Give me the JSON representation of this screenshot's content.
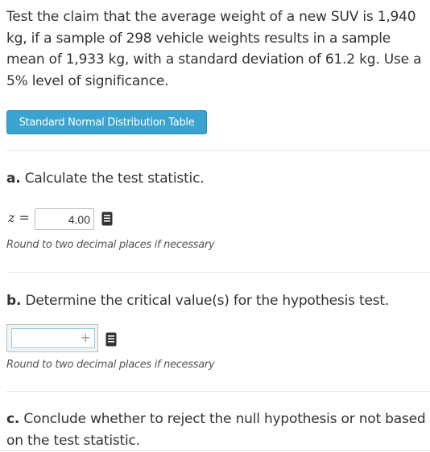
{
  "problem": {
    "text": "Test the claim that the average weight of a new SUV is 1,940 kg, if a sample of 298 vehicle weights results in a sample mean of 1,933 kg, with a standard deviation of 61.2 kg. Use a 5% level of significance."
  },
  "table_button": {
    "label": "Standard Normal Distribution Table"
  },
  "part_a": {
    "letter": "a.",
    "text": " Calculate the test statistic.",
    "z_label": "z =",
    "value": "4.00",
    "hint": "Round to two decimal places if necessary"
  },
  "part_b": {
    "letter": "b.",
    "text": " Determine the critical value(s) for the hypothesis test.",
    "plus_label": "+",
    "hint": "Round to two decimal places if necessary"
  },
  "part_c": {
    "letter": "c.",
    "text": " Conclude whether to reject the null hypothesis or not based on the test statistic."
  },
  "icons": {
    "reference": "book-icon",
    "add": "plus-icon"
  },
  "colors": {
    "button": "#3aa3cf",
    "input_border": "#bdbdbd",
    "focus_border": "#9ccbe6"
  }
}
